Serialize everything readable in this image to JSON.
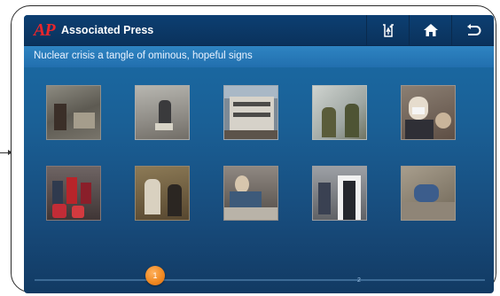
{
  "app": {
    "logo_text": "AP",
    "title": "Associated Press"
  },
  "toolbar": {
    "icons": [
      "share-icon",
      "home-icon",
      "back-icon"
    ]
  },
  "headline": "Nuclear crisis a tangle of ominous, hopeful signs",
  "gallery": {
    "thumbnails": [
      {
        "description": "disaster-rubble-photo"
      },
      {
        "description": "rescue-worker-rubble-photo"
      },
      {
        "description": "damaged-building-photo"
      },
      {
        "description": "officials-map-photo"
      },
      {
        "description": "masked-woman-photo"
      },
      {
        "description": "evacuees-luggage-photo"
      },
      {
        "description": "radiation-screening-photo"
      },
      {
        "description": "evacuees-blankets-photo"
      },
      {
        "description": "press-conference-photo"
      },
      {
        "description": "woman-debris-photo"
      }
    ]
  },
  "pager": {
    "current": "1",
    "next": "2"
  },
  "colors": {
    "accent": "#f08a23",
    "titlebar": "#0d3f72",
    "logo": "#e8262c"
  }
}
